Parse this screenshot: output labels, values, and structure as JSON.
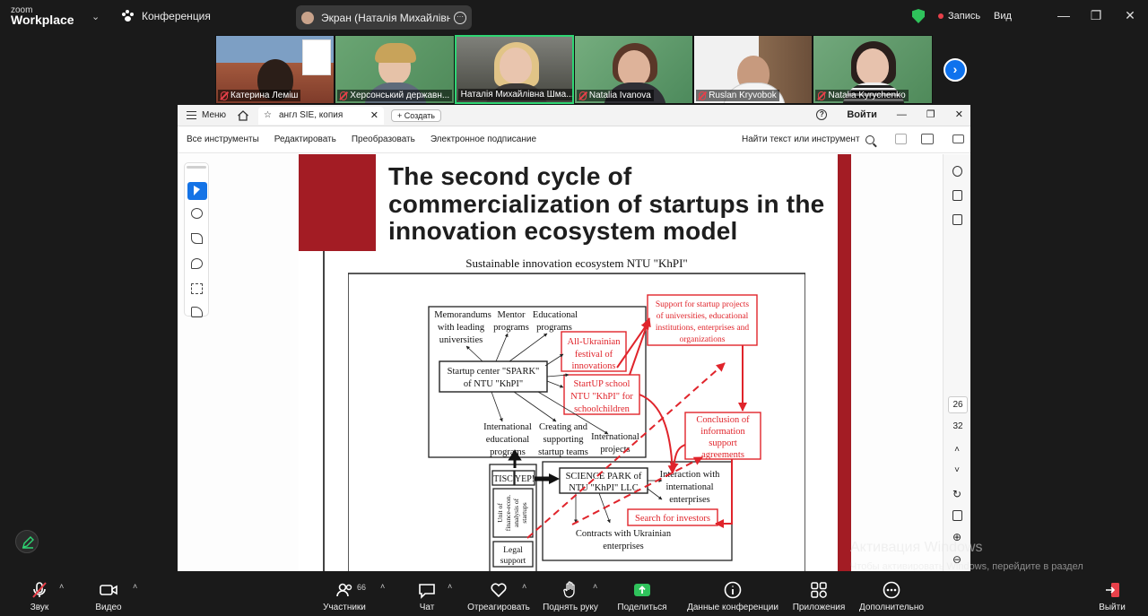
{
  "topbar": {
    "brand_line1": "zoom",
    "brand_line2": "Workplace",
    "conference_label": "Конференция",
    "screen_share_label": "Экран (Наталія Михайлівна Шм",
    "record_label": "Запись",
    "view_label": "Вид"
  },
  "participants": [
    {
      "name": "Катерина Леміш",
      "muted": true
    },
    {
      "name": "Херсонський державн...",
      "muted": true
    },
    {
      "name": "Наталія Михайлівна Шма...",
      "muted": false,
      "active": true
    },
    {
      "name": "Natalia Ivanova",
      "muted": true
    },
    {
      "name": "Ruslan Kryvobok",
      "muted": true
    },
    {
      "name": "Natalia Kyrychenko",
      "muted": true
    }
  ],
  "acrobat": {
    "menu_label": "Меню",
    "tab_title": "англ SIE, копия",
    "new_tab_label": "Создать",
    "sign_in": "Войти",
    "tools": [
      "Все инструменты",
      "Редактировать",
      "Преобразовать",
      "Электронное подписание"
    ],
    "find_label": "Найти текст или инструмент",
    "page_current": "26",
    "page_total": "32"
  },
  "slide": {
    "title": "The second cycle of commercialization of startups in the innovation ecosystem model",
    "subtitle": "Sustainable innovation ecosystem NTU \"KhPI\"",
    "diagram": {
      "memorandums": [
        "Memorandums",
        "with leading",
        "universities"
      ],
      "mentor": [
        "Mentor",
        "programs"
      ],
      "educational": [
        "Educational",
        "programs"
      ],
      "startup_center": [
        "Startup center \"SPARK\"",
        "of NTU \"KhPI\""
      ],
      "festival": [
        "All-Ukrainian",
        "festival of",
        "innovations"
      ],
      "support": [
        "Support for startup projects",
        "of universities, educational",
        "institutions, enterprises and",
        "organizations"
      ],
      "school": [
        "StartUP school",
        "NTU \"KhPI\" for",
        "schoolchildren"
      ],
      "conclusion": [
        "Conclusion of",
        "information",
        "support",
        "agreements"
      ],
      "intl_edu": [
        "International",
        "educational",
        "programs"
      ],
      "creating": [
        "Creating and",
        "supporting",
        "startup teams"
      ],
      "intl_projects": [
        "International",
        "projects"
      ],
      "tisc": "TISC",
      "yep": "YEP!",
      "science_park": [
        "SCIENCE PARK of",
        "NTU \"KhPI\" LLC"
      ],
      "interaction": [
        "Interaction with",
        "international",
        "enterprises"
      ],
      "unit": [
        "Unit of",
        "finance-econ.",
        "analysis of",
        "startups"
      ],
      "investors": "Search for investors",
      "contracts": [
        "Contracts with Ukrainian",
        "enterprises"
      ],
      "legal": [
        "Legal",
        "support"
      ]
    }
  },
  "watermark": {
    "line1": "Активация Windows",
    "line2": "Чтобы активировать Windows, перейдите в раздел \"Параметры\"."
  },
  "bottombar": {
    "audio": "Звук",
    "video": "Видео",
    "participants": "Участники",
    "participants_count": "66",
    "chat": "Чат",
    "react": "Отреагировать",
    "raise_hand": "Поднять руку",
    "share": "Поделиться",
    "info": "Данные конференции",
    "apps": "Приложения",
    "more": "Дополнительно",
    "leave": "Выйти"
  },
  "colors": {
    "zoom_bg": "#1a1a1a",
    "active_speaker": "#2ed573",
    "share_green": "#2fc25b",
    "leave_red": "#e8404a",
    "slide_red": "#a31c24",
    "diagram_red": "#e0242b",
    "acrobat_blue": "#1473e6"
  }
}
